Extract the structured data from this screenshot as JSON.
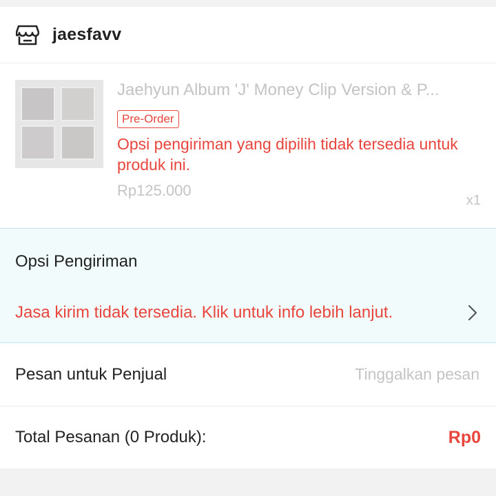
{
  "shop": {
    "name": "jaesfavv",
    "icon": "shop-icon"
  },
  "product": {
    "title": "Jaehyun Album 'J' Money Clip Version & P...",
    "badge": "Pre-Order",
    "warning": "Opsi pengiriman yang dipilih tidak tersedia untuk produk ini.",
    "price": "Rp125.000",
    "quantity": "x1"
  },
  "shipping": {
    "label": "Opsi Pengiriman",
    "error": "Jasa kirim tidak tersedia. Klik untuk info lebih lanjut.",
    "icon": "chevron-right-icon"
  },
  "message": {
    "label": "Pesan untuk Penjual",
    "placeholder": "Tinggalkan pesan",
    "value": ""
  },
  "total": {
    "label": "Total Pesanan (0 Produk):",
    "value": "Rp0"
  },
  "colors": {
    "accent": "#e8453c",
    "muted": "#c4c4c4",
    "shipping_bg": "#f1fbfb"
  }
}
